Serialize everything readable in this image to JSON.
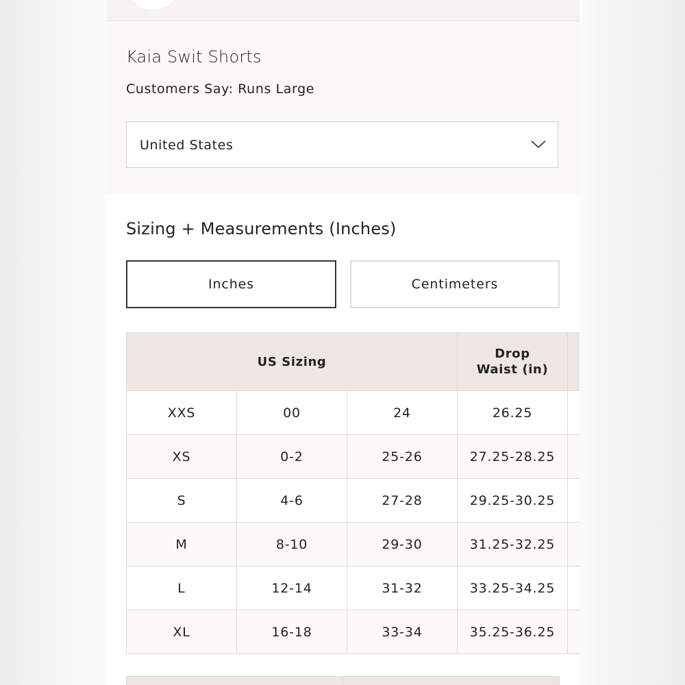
{
  "product": {
    "title": "Kaia Swit Shorts",
    "fit_note": "Customers Say: Runs Large"
  },
  "country_select": {
    "value": "United States",
    "icon": "chevron-down-icon"
  },
  "measurements": {
    "heading": "Sizing + Measurements (Inches)",
    "unit_toggle": {
      "inches": "Inches",
      "centimeters": "Centimeters",
      "selected": "Inches"
    },
    "table": {
      "headers": {
        "us_sizing": "US Sizing",
        "drop_waist_line1": "Drop",
        "drop_waist_line2": "Waist (in)"
      },
      "rows": [
        {
          "size": "XXS",
          "numeric": "00",
          "jeans": "24",
          "drop_waist": "26.25"
        },
        {
          "size": "XS",
          "numeric": "0-2",
          "jeans": "25-26",
          "drop_waist": "27.25-28.25"
        },
        {
          "size": "S",
          "numeric": "4-6",
          "jeans": "27-28",
          "drop_waist": "29.25-30.25"
        },
        {
          "size": "M",
          "numeric": "8-10",
          "jeans": "29-30",
          "drop_waist": "31.25-32.25"
        },
        {
          "size": "L",
          "numeric": "12-14",
          "jeans": "31-32",
          "drop_waist": "33.25-34.25"
        },
        {
          "size": "XL",
          "numeric": "16-18",
          "jeans": "33-34",
          "drop_waist": "35.25-36.25"
        }
      ]
    }
  },
  "colors": {
    "header_bg": "#ede6e2",
    "section_bg": "#fbf8f6",
    "border": "#dcdcdc",
    "text": "#222222"
  }
}
